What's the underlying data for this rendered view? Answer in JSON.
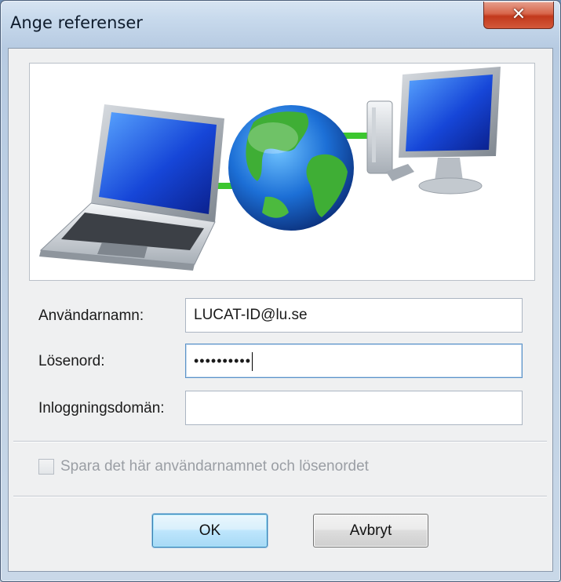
{
  "window": {
    "title": "Ange referenser",
    "close_icon": "close-icon"
  },
  "banner": {
    "illustration": "network-illustration",
    "items": [
      "laptop-icon",
      "globe-icon",
      "desktop-computer-icon"
    ]
  },
  "form": {
    "username_label": "Användarnamn:",
    "username_value": "LUCAT-ID@lu.se",
    "password_label": "Lösenord:",
    "password_mask": "••••••••••",
    "domain_label": "Inloggningsdomän:",
    "domain_value": ""
  },
  "remember": {
    "label": "Spara det här användarnamnet och lösenordet",
    "checked": false,
    "enabled": false
  },
  "buttons": {
    "ok_label": "OK",
    "cancel_label": "Avbryt"
  },
  "colors": {
    "close_button": "#c2391c",
    "ok_button": "#bee6fd",
    "network_link": "#3cc62f"
  }
}
